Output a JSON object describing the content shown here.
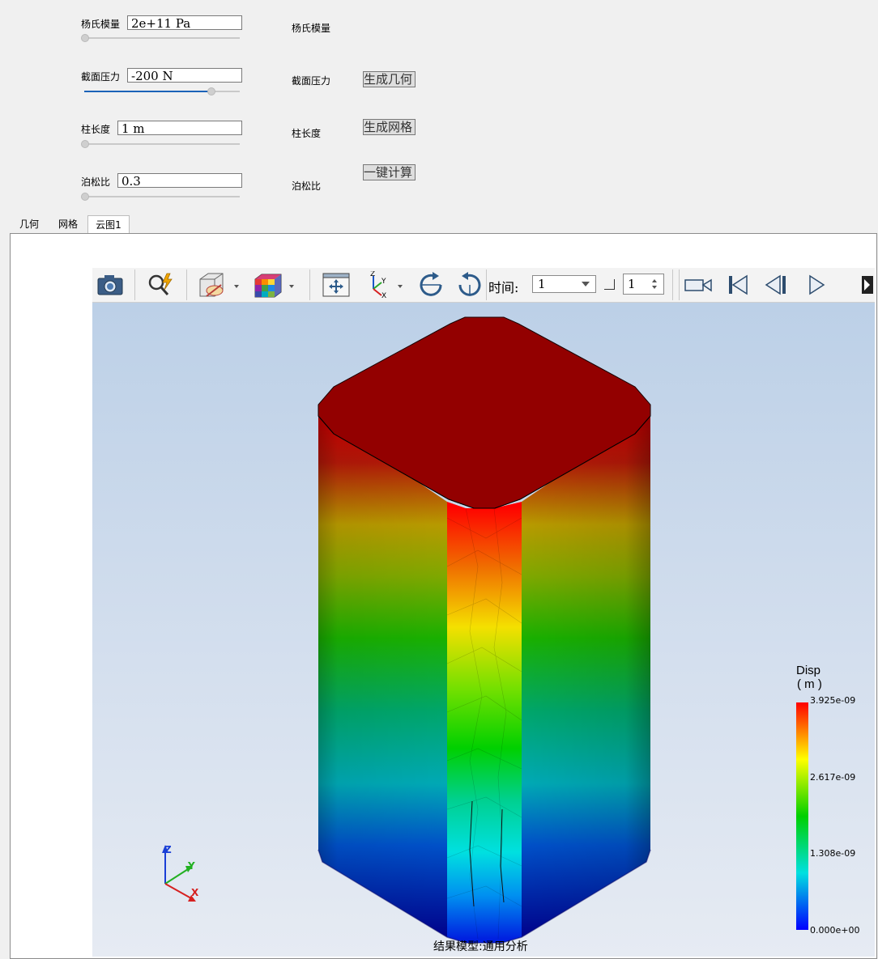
{
  "params": [
    {
      "label": "杨氏模量",
      "value": "2e+11 Pa",
      "side_label": "杨氏模量",
      "slider": 0.0
    },
    {
      "label": "截面压力",
      "value": "-200 N",
      "side_label": "截面压力",
      "slider": 0.82
    },
    {
      "label": "柱长度",
      "value": "1 m",
      "side_label": "柱长度",
      "slider": 0.0
    },
    {
      "label": "泊松比",
      "value": "0.3",
      "side_label": "泊松比",
      "slider": 0.0
    }
  ],
  "buttons": {
    "gen_geometry": "生成几何",
    "gen_mesh": "生成网格",
    "one_click_compute": "一键计算"
  },
  "tabs": [
    {
      "label": "几何"
    },
    {
      "label": "网格"
    },
    {
      "label": "云图1",
      "active": true
    }
  ],
  "toolbar": {
    "time_label": "时间:",
    "time_value": "1",
    "step_value": "1",
    "icons": [
      "camera-icon",
      "probe-icon",
      "visibility-icon",
      "color-map-icon",
      "fit-view-icon",
      "axes-icon",
      "rotate-cw-icon",
      "rotate-ccw-icon",
      "record-icon",
      "first-frame-icon",
      "prev-frame-icon",
      "play-icon",
      "more-icon"
    ]
  },
  "legend": {
    "title": "Disp",
    "unit": "( m )",
    "ticks": [
      "3.925e-09",
      "2.617e-09",
      "1.308e-09",
      "0.000e+00"
    ],
    "colors": [
      "#ff0000",
      "#ffff00",
      "#00d000",
      "#00e0e0",
      "#0000ff"
    ]
  },
  "triad": {
    "z": "Z",
    "y": "Y",
    "x": "X"
  },
  "model_caption": "结果模型:通用分析"
}
